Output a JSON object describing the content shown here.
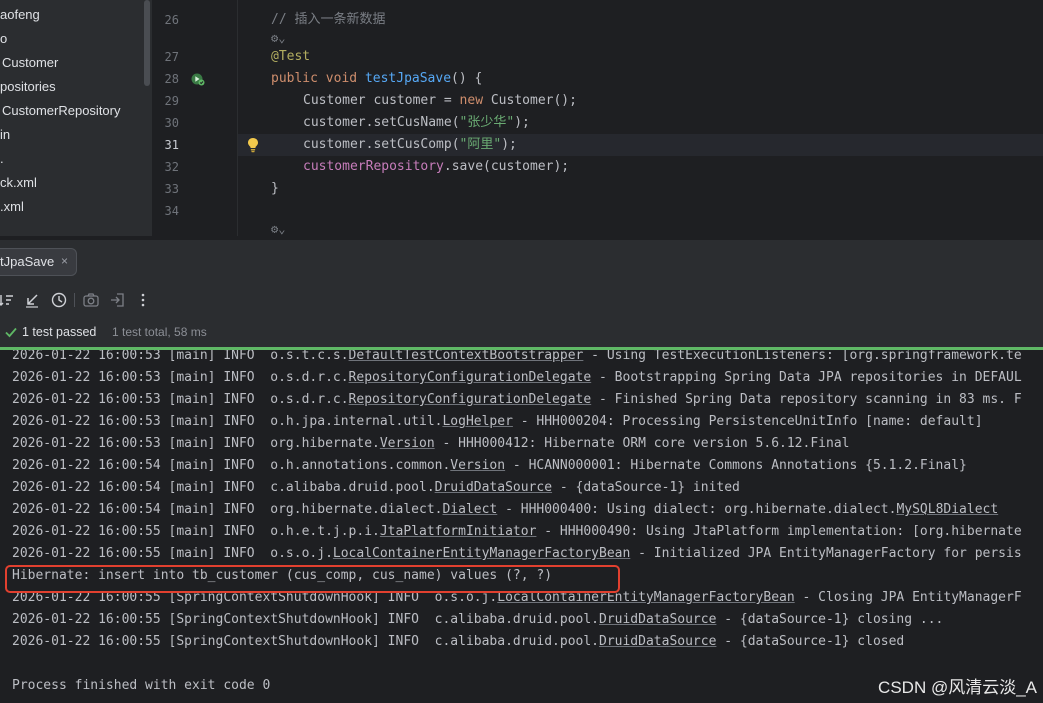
{
  "project_tree": {
    "items": [
      "aofeng",
      "o",
      "Customer",
      "positories",
      "CustomerRepository",
      "in",
      ".",
      "ck.xml",
      ".xml"
    ]
  },
  "editor": {
    "line_numbers": [
      "26",
      "27",
      "28",
      "29",
      "30",
      "31",
      "32",
      "33",
      "34"
    ],
    "current_line": "31",
    "lines": {
      "comment": "// 插入一条新数据",
      "hint1": "⚙⌄",
      "annotation": "@Test",
      "method_kw1": "public",
      "method_kw2": "void",
      "method_name": "testJpaSave",
      "method_tail": "() {",
      "l29_a": "Customer customer = ",
      "l29_kw": "new",
      "l29_b": " Customer();",
      "l30_a": "customer.setCusName(",
      "l30_str": "\"张少华\"",
      "l30_b": ");",
      "l31_a": "customer.setCusComp(",
      "l31_str": "\"阿里\"",
      "l31_b": ");",
      "l32_field": "customerRepository",
      "l32_b": ".save(customer);",
      "l33": "}",
      "hint2": "⚙⌄"
    }
  },
  "run_panel": {
    "tab_label": "tJpaSave",
    "tab_close": "×",
    "status": {
      "passed": "1 test passed",
      "total": "1 test total, 58 ms"
    }
  },
  "console": {
    "lines": [
      {
        "pre": "2026-01-22 16:00:53 [main] INFO  o.s.t.c.s.",
        "u": "DefaultTestContextBootstrapper",
        "post": " - Using TestExecutionListeners: [org.springframework.te"
      },
      {
        "pre": "2026-01-22 16:00:53 [main] INFO  o.s.d.r.c.",
        "u": "RepositoryConfigurationDelegate",
        "post": " - Bootstrapping Spring Data JPA repositories in DEFAUL"
      },
      {
        "pre": "2026-01-22 16:00:53 [main] INFO  o.s.d.r.c.",
        "u": "RepositoryConfigurationDelegate",
        "post": " - Finished Spring Data repository scanning in 83 ms. F"
      },
      {
        "pre": "2026-01-22 16:00:53 [main] INFO  o.h.jpa.internal.util.",
        "u": "LogHelper",
        "post": " - HHH000204: Processing PersistenceUnitInfo [name: default]"
      },
      {
        "pre": "2026-01-22 16:00:53 [main] INFO  org.hibernate.",
        "u": "Version",
        "post": " - HHH000412: Hibernate ORM core version 5.6.12.Final"
      },
      {
        "pre": "2026-01-22 16:00:54 [main] INFO  o.h.annotations.common.",
        "u": "Version",
        "post": " - HCANN000001: Hibernate Commons Annotations {5.1.2.Final}"
      },
      {
        "pre": "2026-01-22 16:00:54 [main] INFO  c.alibaba.druid.pool.",
        "u": "DruidDataSource",
        "post": " - {dataSource-1} inited"
      },
      {
        "pre": "2026-01-22 16:00:54 [main] INFO  org.hibernate.dialect.",
        "u": "Dialect",
        "post": " - HHH000400: Using dialect: org.hibernate.dialect.",
        "u2": "MySQL8Dialect"
      },
      {
        "pre": "2026-01-22 16:00:55 [main] INFO  o.h.e.t.j.p.i.",
        "u": "JtaPlatformInitiator",
        "post": " - HHH000490: Using JtaPlatform implementation: [org.hibernate"
      },
      {
        "pre": "2026-01-22 16:00:55 [main] INFO  o.s.o.j.",
        "u": "LocalContainerEntityManagerFactoryBean",
        "post": " - Initialized JPA EntityManagerFactory for persis"
      },
      {
        "pre": "Hibernate: insert into tb_customer (cus_comp, cus_name) values (?, ?)",
        "u": "",
        "post": ""
      },
      {
        "pre": "2026-01-22 16:00:55 [SpringContextShutdownHook] INFO  o.s.o.j.",
        "u": "LocalContainerEntityManagerFactoryBean",
        "post": " - Closing JPA EntityManagerF"
      },
      {
        "pre": "2026-01-22 16:00:55 [SpringContextShutdownHook] INFO  c.alibaba.druid.pool.",
        "u": "DruidDataSource",
        "post": " - {dataSource-1} closing ..."
      },
      {
        "pre": "2026-01-22 16:00:55 [SpringContextShutdownHook] INFO  c.alibaba.druid.pool.",
        "u": "DruidDataSource",
        "post": " - {dataSource-1} closed"
      },
      {
        "pre": "",
        "u": "",
        "post": ""
      },
      {
        "pre": "Process finished with exit code 0",
        "u": "",
        "post": ""
      }
    ],
    "watermark": "CSDN @风清云淡_A"
  },
  "colors": {
    "accent_pass": "#5fb865",
    "highlight_box": "#e2402f"
  }
}
